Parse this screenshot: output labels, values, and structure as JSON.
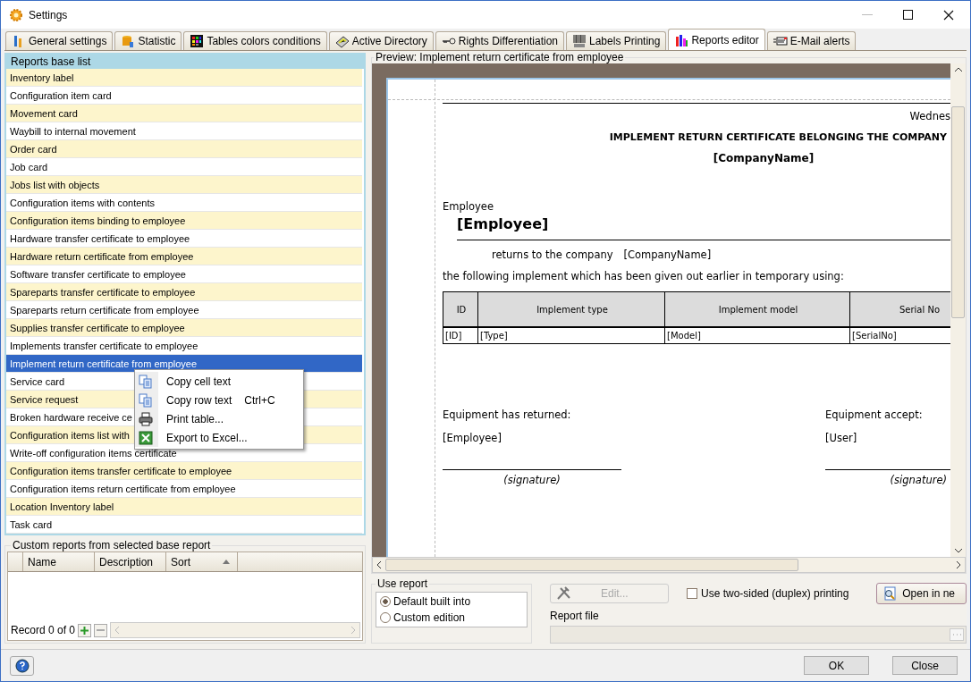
{
  "window": {
    "title": "Settings"
  },
  "tabs": [
    {
      "label": "General settings",
      "selected": false
    },
    {
      "label": "Statistic",
      "selected": false
    },
    {
      "label": "Tables colors conditions",
      "selected": false
    },
    {
      "label": "Active Directory",
      "selected": false
    },
    {
      "label": "Rights Differentiation",
      "selected": false
    },
    {
      "label": "Labels Printing",
      "selected": false
    },
    {
      "label": "Reports editor",
      "selected": true
    },
    {
      "label": "E-Mail alerts",
      "selected": false
    }
  ],
  "reports_base_list": {
    "title": "Reports base list",
    "items": [
      {
        "label": "Inventory label",
        "selected": false
      },
      {
        "label": "Configuration item card",
        "selected": false
      },
      {
        "label": "Movement card",
        "selected": false
      },
      {
        "label": "Waybill to internal movement",
        "selected": false
      },
      {
        "label": "Order card",
        "selected": false
      },
      {
        "label": "Job card",
        "selected": false
      },
      {
        "label": "Jobs list with objects",
        "selected": false
      },
      {
        "label": "Configuration items with contents",
        "selected": false
      },
      {
        "label": "Configuration items binding to employee",
        "selected": false
      },
      {
        "label": "Hardware transfer certificate to employee",
        "selected": false
      },
      {
        "label": "Hardware return certificate from employee",
        "selected": false
      },
      {
        "label": "Software transfer certificate to employee",
        "selected": false
      },
      {
        "label": "Spareparts transfer certificate to employee",
        "selected": false
      },
      {
        "label": "Spareparts return certificate from employee",
        "selected": false
      },
      {
        "label": "Supplies transfer certificate to employee",
        "selected": false
      },
      {
        "label": "Implements transfer certificate to employee",
        "selected": false
      },
      {
        "label": "Implement return certificate from employee",
        "selected": true
      },
      {
        "label": "Service card",
        "selected": false
      },
      {
        "label": "Service request",
        "selected": false
      },
      {
        "label": "Broken hardware receive ce",
        "selected": false
      },
      {
        "label": "Configuration items list with",
        "selected": false
      },
      {
        "label": "Write-off configuration items certificate",
        "selected": false
      },
      {
        "label": "Configuration items transfer certificate to employee",
        "selected": false
      },
      {
        "label": "Configuration items return certificate from employee",
        "selected": false
      },
      {
        "label": "Location Inventory label",
        "selected": false
      },
      {
        "label": "Task card",
        "selected": false
      }
    ]
  },
  "context_menu": [
    {
      "label": "Copy cell text"
    },
    {
      "label": "Copy row text",
      "shortcut": "Ctrl+C"
    },
    {
      "label": "Print table..."
    },
    {
      "label": "Export to Excel..."
    }
  ],
  "custom_reports": {
    "title": "Custom reports from selected base report",
    "columns": [
      "Name",
      "Description",
      "Sort"
    ],
    "record_count": "Record 0 of 0"
  },
  "preview": {
    "title": "Preview: Implement return certificate from employee",
    "date": "Wednes",
    "heading": "IMPLEMENT RETURN CERTIFICATE BELONGING THE COMPANY",
    "company": "[CompanyName]",
    "employee_label": "Employee",
    "employee": "[Employee]",
    "returns_label": "returns to the company",
    "returns_company": "[CompanyName]",
    "following": "the following implement which has been given out earlier in temporary using:",
    "table": {
      "columns": [
        "ID",
        "Implement type",
        "Implement model",
        "Serial No"
      ],
      "row": [
        "[ID]",
        "[Type]",
        "[Model]",
        "[SerialNo]"
      ]
    },
    "returned_label": "Equipment has returned:",
    "returned_value": "[Employee]",
    "accept_label": "Equipment accept:",
    "accept_value": "[User]",
    "signatures": [
      "(signature)",
      "(signature)"
    ]
  },
  "use_report": {
    "title": "Use report",
    "options": [
      {
        "label": "Default built into",
        "selected": true
      },
      {
        "label": "Custom edition",
        "selected": false
      }
    ]
  },
  "edit_button": {
    "label": "Edit...",
    "disabled": true
  },
  "duplex": {
    "label": "Use two-sided (duplex) printing",
    "checked": false
  },
  "open_button": "Open in ne",
  "report_file": {
    "label": "Report file"
  },
  "buttons": [
    "OK",
    "Close"
  ]
}
